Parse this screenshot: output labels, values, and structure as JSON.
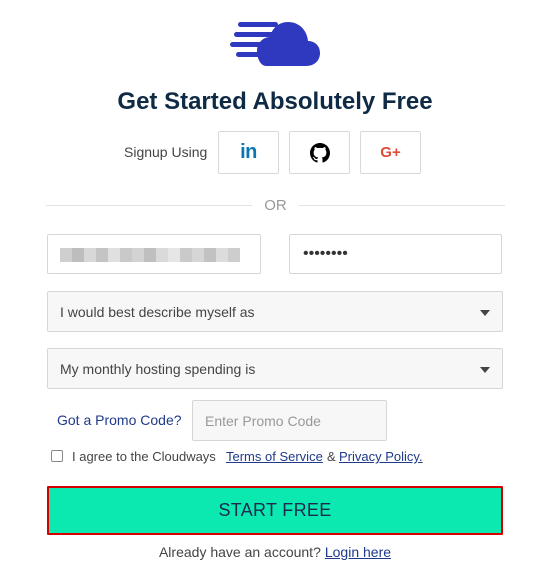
{
  "brand": {
    "logo_icon": "cloud-speed-icon",
    "color": "#2f39bf"
  },
  "title": "Get Started Absolutely Free",
  "signup": {
    "label": "Signup Using",
    "providers": [
      {
        "name": "LinkedIn",
        "icon": "linkedin-icon",
        "glyph": "in",
        "color": "#0a77b5"
      },
      {
        "name": "GitHub",
        "icon": "github-icon",
        "color": "#000000"
      },
      {
        "name": "Google Plus",
        "icon": "google-plus-icon",
        "glyph": "G+",
        "color": "#dd4b39"
      }
    ]
  },
  "divider": {
    "text": "OR"
  },
  "form": {
    "email": {
      "value": "",
      "placeholder": ""
    },
    "password": {
      "value": "••••••••"
    },
    "describe_select": {
      "value": "I would best describe myself as"
    },
    "spending_select": {
      "value": "My monthly hosting spending is"
    },
    "promo": {
      "label": "Got a Promo Code?",
      "placeholder": "Enter Promo Code"
    },
    "agree": {
      "checked": false,
      "text": "I agree to the Cloudways",
      "terms_label": "Terms of Service",
      "amp": "&",
      "privacy_label": "Privacy Policy."
    },
    "submit_label": "START FREE"
  },
  "footer": {
    "text": "Already have an account?",
    "login_label": "Login here"
  },
  "colors": {
    "accent": "#0be8b0",
    "highlight_border": "#d40000",
    "title": "#0f2a44",
    "link": "#1f3a8a"
  }
}
